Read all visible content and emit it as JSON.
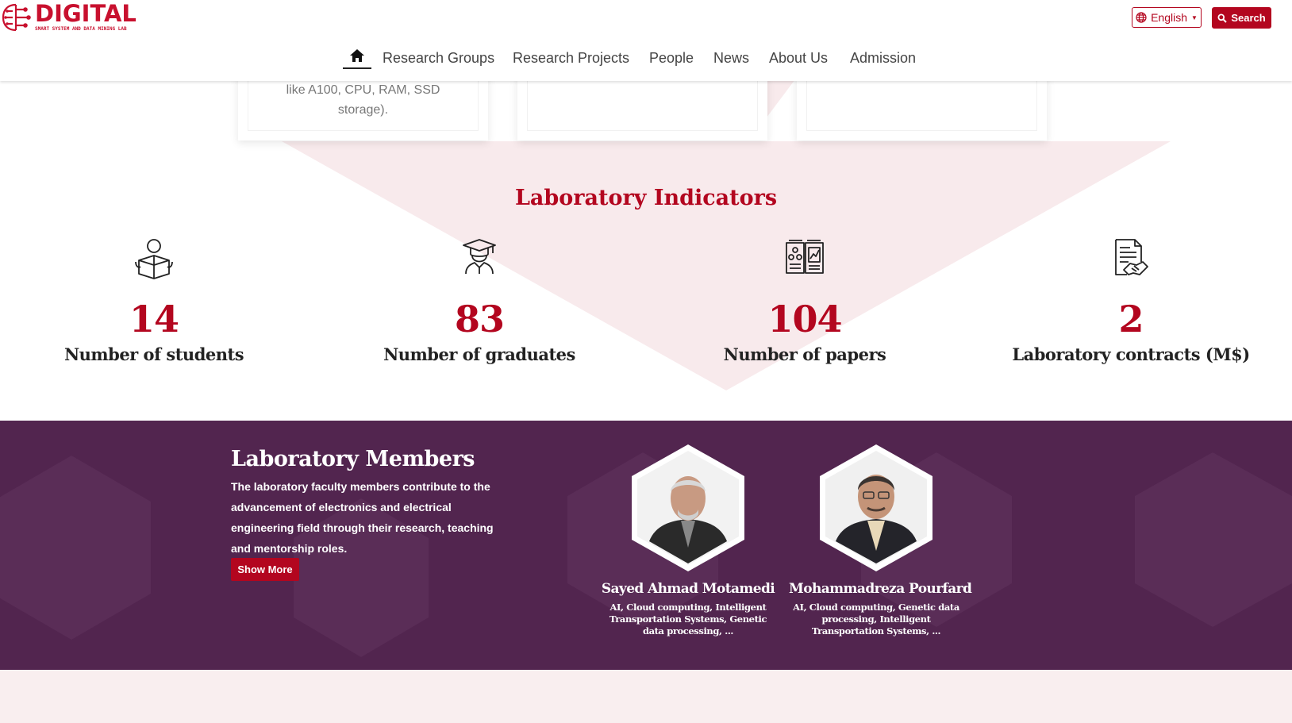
{
  "brand": {
    "title": "DIGITAL",
    "subtitle": "SMART SYSTEM AND DATA MINING LAB",
    "color": "#c8102e"
  },
  "header": {
    "language": "English",
    "search_label": "Search"
  },
  "nav": {
    "home_icon": "home-icon",
    "items": [
      {
        "label": "Research Groups"
      },
      {
        "label": "Research Projects"
      },
      {
        "label": "People"
      },
      {
        "label": "News"
      },
      {
        "label": "About Us"
      },
      {
        "label": "Admission"
      }
    ]
  },
  "cards": [
    {
      "text": "like A100, CPU, RAM, SSD storage)."
    },
    {
      "text": ""
    },
    {
      "text": ""
    }
  ],
  "indicators": {
    "title": "Laboratory Indicators",
    "items": [
      {
        "icon": "student-reading-icon",
        "value": "14",
        "label": "Number of students"
      },
      {
        "icon": "graduate-icon",
        "value": "83",
        "label": "Number of graduates"
      },
      {
        "icon": "open-book-icon",
        "value": "104",
        "label": "Number of papers"
      },
      {
        "icon": "contract-handshake-icon",
        "value": "2",
        "label": "Laboratory contracts (M$)"
      }
    ]
  },
  "members": {
    "title": "Laboratory Members",
    "description": "The laboratory faculty members contribute to the advancement of electronics and electrical engineering field through their research, teaching and mentorship roles.",
    "show_more": "Show More",
    "people": [
      {
        "name": "Sayed Ahmad Motamedi",
        "fields": "AI, Cloud computing, Intelligent Transportation Systems, Genetic data processing, ..."
      },
      {
        "name": "Mohammadreza Pourfard",
        "fields": "AI, Cloud computing, Genetic data processing, Intelligent Transportation Systems, ..."
      }
    ]
  },
  "colors": {
    "accent": "#b3061f",
    "members_bg": "#52254f",
    "triangle": "#f8eaec"
  }
}
